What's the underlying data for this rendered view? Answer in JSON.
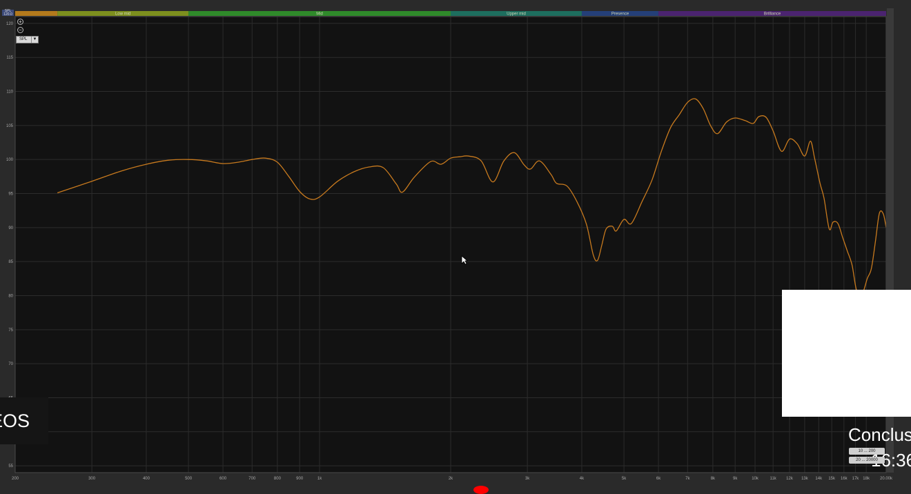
{
  "chart_data": {
    "type": "line",
    "title": "",
    "xlabel": "",
    "ylabel": "",
    "x_scale": "log",
    "xlim": [
      200,
      20000
    ],
    "ylim": [
      54,
      121
    ],
    "grid": true,
    "y_ticks": [
      55,
      60,
      65,
      70,
      75,
      80,
      85,
      90,
      95,
      100,
      105,
      110,
      115,
      120
    ],
    "x_ticks": [
      {
        "v": 200,
        "label": "200"
      },
      {
        "v": 300,
        "label": "300"
      },
      {
        "v": 400,
        "label": "400"
      },
      {
        "v": 500,
        "label": "500"
      },
      {
        "v": 600,
        "label": "600"
      },
      {
        "v": 700,
        "label": "700"
      },
      {
        "v": 800,
        "label": "800"
      },
      {
        "v": 900,
        "label": "900"
      },
      {
        "v": 1000,
        "label": "1k"
      },
      {
        "v": 2000,
        "label": "2k"
      },
      {
        "v": 3000,
        "label": "3k"
      },
      {
        "v": 4000,
        "label": "4k"
      },
      {
        "v": 5000,
        "label": "5k"
      },
      {
        "v": 6000,
        "label": "6k"
      },
      {
        "v": 7000,
        "label": "7k"
      },
      {
        "v": 8000,
        "label": "8k"
      },
      {
        "v": 9000,
        "label": "9k"
      },
      {
        "v": 10000,
        "label": "10k"
      },
      {
        "v": 11000,
        "label": "11k"
      },
      {
        "v": 12000,
        "label": "12k"
      },
      {
        "v": 13000,
        "label": "13k"
      },
      {
        "v": 14000,
        "label": "14k"
      },
      {
        "v": 15000,
        "label": "15k"
      },
      {
        "v": 16000,
        "label": "16k"
      },
      {
        "v": 17000,
        "label": "17k"
      },
      {
        "v": 18000,
        "label": "18k"
      },
      {
        "v": 20000,
        "label": "20.00k"
      }
    ],
    "bands": [
      {
        "label": "",
        "from": 200,
        "to": 250,
        "color": "#b47a1c"
      },
      {
        "label": "Low mid",
        "from": 250,
        "to": 500,
        "color": "#7d8f1e"
      },
      {
        "label": "Mid",
        "from": 500,
        "to": 2000,
        "color": "#2f8a2a"
      },
      {
        "label": "Upper mid",
        "from": 2000,
        "to": 4000,
        "color": "#1d6e5e"
      },
      {
        "label": "Presence",
        "from": 4000,
        "to": 6000,
        "color": "#243f78"
      },
      {
        "label": "Brilliance",
        "from": 6000,
        "to": 20000,
        "color": "#4b2370"
      }
    ],
    "series": [
      {
        "color": "#c87a1e",
        "points": [
          [
            250,
            95.1
          ],
          [
            300,
            96.8
          ],
          [
            350,
            98.3
          ],
          [
            400,
            99.3
          ],
          [
            450,
            99.9
          ],
          [
            500,
            100.0
          ],
          [
            550,
            99.8
          ],
          [
            600,
            99.4
          ],
          [
            650,
            99.6
          ],
          [
            700,
            100.0
          ],
          [
            750,
            100.2
          ],
          [
            800,
            99.6
          ],
          [
            850,
            97.5
          ],
          [
            900,
            95.3
          ],
          [
            950,
            94.2
          ],
          [
            1000,
            94.5
          ],
          [
            1100,
            96.8
          ],
          [
            1200,
            98.2
          ],
          [
            1300,
            98.9
          ],
          [
            1400,
            98.8
          ],
          [
            1500,
            96.4
          ],
          [
            1550,
            95.2
          ],
          [
            1650,
            97.4
          ],
          [
            1800,
            99.7
          ],
          [
            1900,
            99.3
          ],
          [
            2000,
            100.2
          ],
          [
            2100,
            100.4
          ],
          [
            2200,
            100.5
          ],
          [
            2350,
            99.8
          ],
          [
            2500,
            96.7
          ],
          [
            2650,
            99.8
          ],
          [
            2800,
            101.0
          ],
          [
            2950,
            99.2
          ],
          [
            3050,
            98.6
          ],
          [
            3200,
            99.8
          ],
          [
            3400,
            97.8
          ],
          [
            3500,
            96.5
          ],
          [
            3700,
            96.1
          ],
          [
            3900,
            93.8
          ],
          [
            4100,
            90.5
          ],
          [
            4250,
            86.0
          ],
          [
            4350,
            85.2
          ],
          [
            4450,
            87.5
          ],
          [
            4550,
            89.8
          ],
          [
            4700,
            90.2
          ],
          [
            4800,
            89.5
          ],
          [
            5000,
            91.2
          ],
          [
            5200,
            90.6
          ],
          [
            5500,
            93.8
          ],
          [
            5800,
            97.0
          ],
          [
            6100,
            101.3
          ],
          [
            6400,
            104.7
          ],
          [
            6700,
            106.6
          ],
          [
            7000,
            108.4
          ],
          [
            7300,
            108.9
          ],
          [
            7600,
            107.5
          ],
          [
            7900,
            105.0
          ],
          [
            8200,
            103.8
          ],
          [
            8600,
            105.5
          ],
          [
            9000,
            106.1
          ],
          [
            9500,
            105.7
          ],
          [
            9900,
            105.3
          ],
          [
            10200,
            106.3
          ],
          [
            10600,
            106.2
          ],
          [
            11000,
            104.2
          ],
          [
            11500,
            101.2
          ],
          [
            12000,
            103.0
          ],
          [
            12500,
            102.3
          ],
          [
            13000,
            100.5
          ],
          [
            13400,
            102.7
          ],
          [
            13700,
            100.2
          ],
          [
            14100,
            96.5
          ],
          [
            14400,
            94.3
          ],
          [
            14800,
            89.8
          ],
          [
            15100,
            90.8
          ],
          [
            15500,
            90.6
          ],
          [
            15900,
            88.5
          ],
          [
            16300,
            86.5
          ],
          [
            16700,
            84.5
          ],
          [
            17100,
            80.8
          ],
          [
            17600,
            80.2
          ],
          [
            18100,
            82.5
          ],
          [
            18500,
            84.0
          ],
          [
            18900,
            88.0
          ],
          [
            19300,
            92.1
          ],
          [
            19700,
            92.0
          ],
          [
            20000,
            90.0
          ]
        ]
      }
    ]
  },
  "ui": {
    "spl_select": "SPL",
    "spl_arrow": "▼",
    "corner_label": "SPL 120.0",
    "zoom_in": "+",
    "zoom_out": "−",
    "videos_text": "EOS",
    "conclusion_text": "Conclus",
    "timestamp_text": "16:36",
    "range_a": "10 ... 200",
    "range_b": "20 ... 20000"
  },
  "colors": {
    "plot_bg": "#121212",
    "grid": "#2c2c2c",
    "curve": "#c87a1e",
    "frame": "#3a3a3a"
  }
}
